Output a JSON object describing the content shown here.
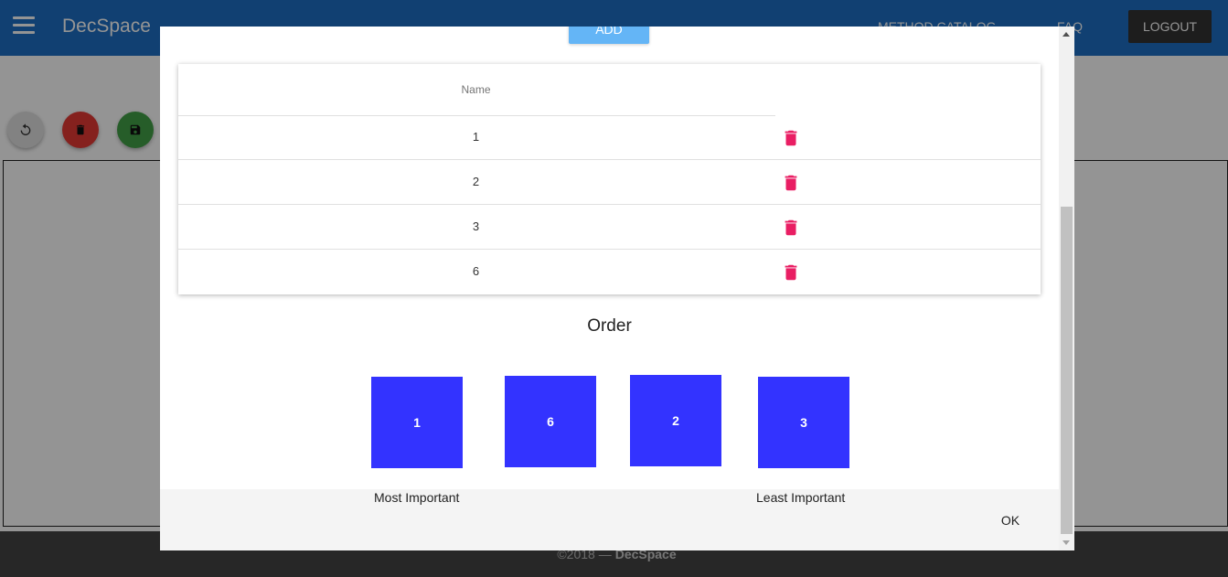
{
  "navbar": {
    "brand": "DecSpace",
    "links": [
      "METHOD CATALOG",
      "FAQ"
    ],
    "logout_label": "LOGOUT"
  },
  "toolbar": {
    "icons": [
      "undo-icon",
      "trash-icon",
      "save-icon"
    ]
  },
  "footer": {
    "copyright": "©2018 —",
    "brand": "DecSpace"
  },
  "modal": {
    "add_label": "ADD",
    "table": {
      "header_name": "Name",
      "rows": [
        {
          "name": "1"
        },
        {
          "name": "2"
        },
        {
          "name": "3"
        },
        {
          "name": "6"
        }
      ],
      "delete_icon_color": "#e91e63"
    },
    "order_title": "Order",
    "order_items": [
      "1",
      "6",
      "2",
      "3"
    ],
    "order_color": "#3333ff",
    "most_important_label": "Most Important",
    "least_important_label": "Least Important",
    "ok_label": "OK"
  }
}
